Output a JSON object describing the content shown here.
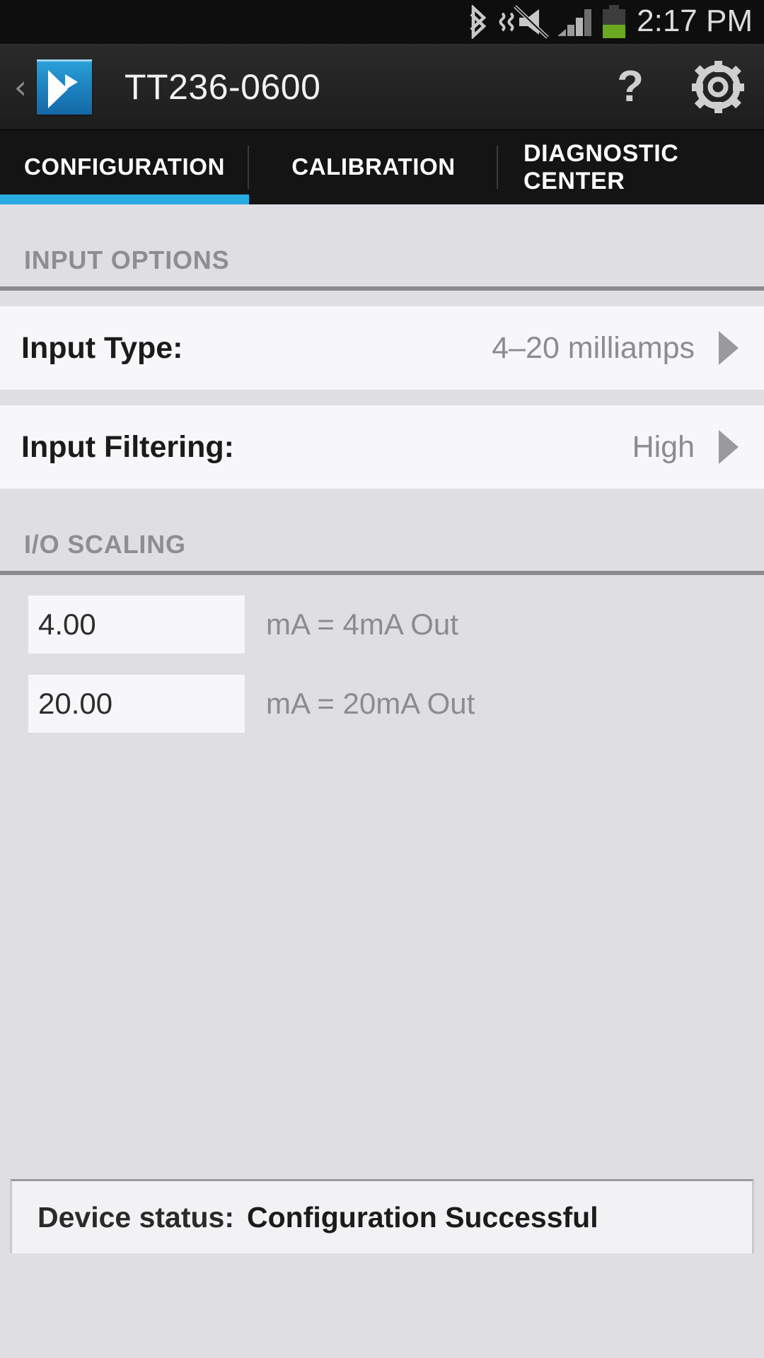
{
  "status_bar": {
    "time": "2:17 PM",
    "icons": [
      {
        "name": "bluetooth-icon",
        "label": "Bluetooth"
      },
      {
        "name": "volume-mute-vibrate-icon",
        "label": "Silent with vibrate"
      },
      {
        "name": "cellular-signal-icon",
        "label": "Signal 4 bars"
      },
      {
        "name": "battery-icon",
        "label": "Battery"
      }
    ],
    "battery_level_percent": 45,
    "signal_bars": 4,
    "battery_fill_color": "#6aa821",
    "background_color": "#0e0e0e"
  },
  "action_bar": {
    "back_label": "‹",
    "app_icon_name": "app-logo-icon",
    "title": "TT236-0600",
    "help_label": "?",
    "settings_icon_name": "gear-icon",
    "accent_color": "#1b7fbe"
  },
  "tabs": {
    "active_index": 0,
    "indicator_color": "#29abe2",
    "items": [
      {
        "label": "CONFIGURATION",
        "name": "tab-configuration"
      },
      {
        "label": "CALIBRATION",
        "name": "tab-calibration"
      },
      {
        "label": "DIAGNOSTIC CENTER",
        "name": "tab-diagnostic-center"
      }
    ]
  },
  "content": {
    "sections": [
      {
        "header": "INPUT OPTIONS",
        "rows": [
          {
            "label": "Input Type:",
            "value": "4–20 milliamps",
            "name": "row-input-type"
          },
          {
            "label": "Input Filtering:",
            "value": "High",
            "name": "row-input-filtering"
          }
        ]
      },
      {
        "header": "I/O SCALING",
        "scaling": [
          {
            "value": "4.00",
            "placeholder": "0.00",
            "suffix": "mA = 4mA Out",
            "name": "scaling-low"
          },
          {
            "value": "20.00",
            "placeholder": "0.00",
            "suffix": "mA = 20mA Out",
            "name": "scaling-high"
          }
        ]
      }
    ]
  },
  "bottom_status": {
    "label": "Device status:",
    "value": "Configuration Successful"
  }
}
